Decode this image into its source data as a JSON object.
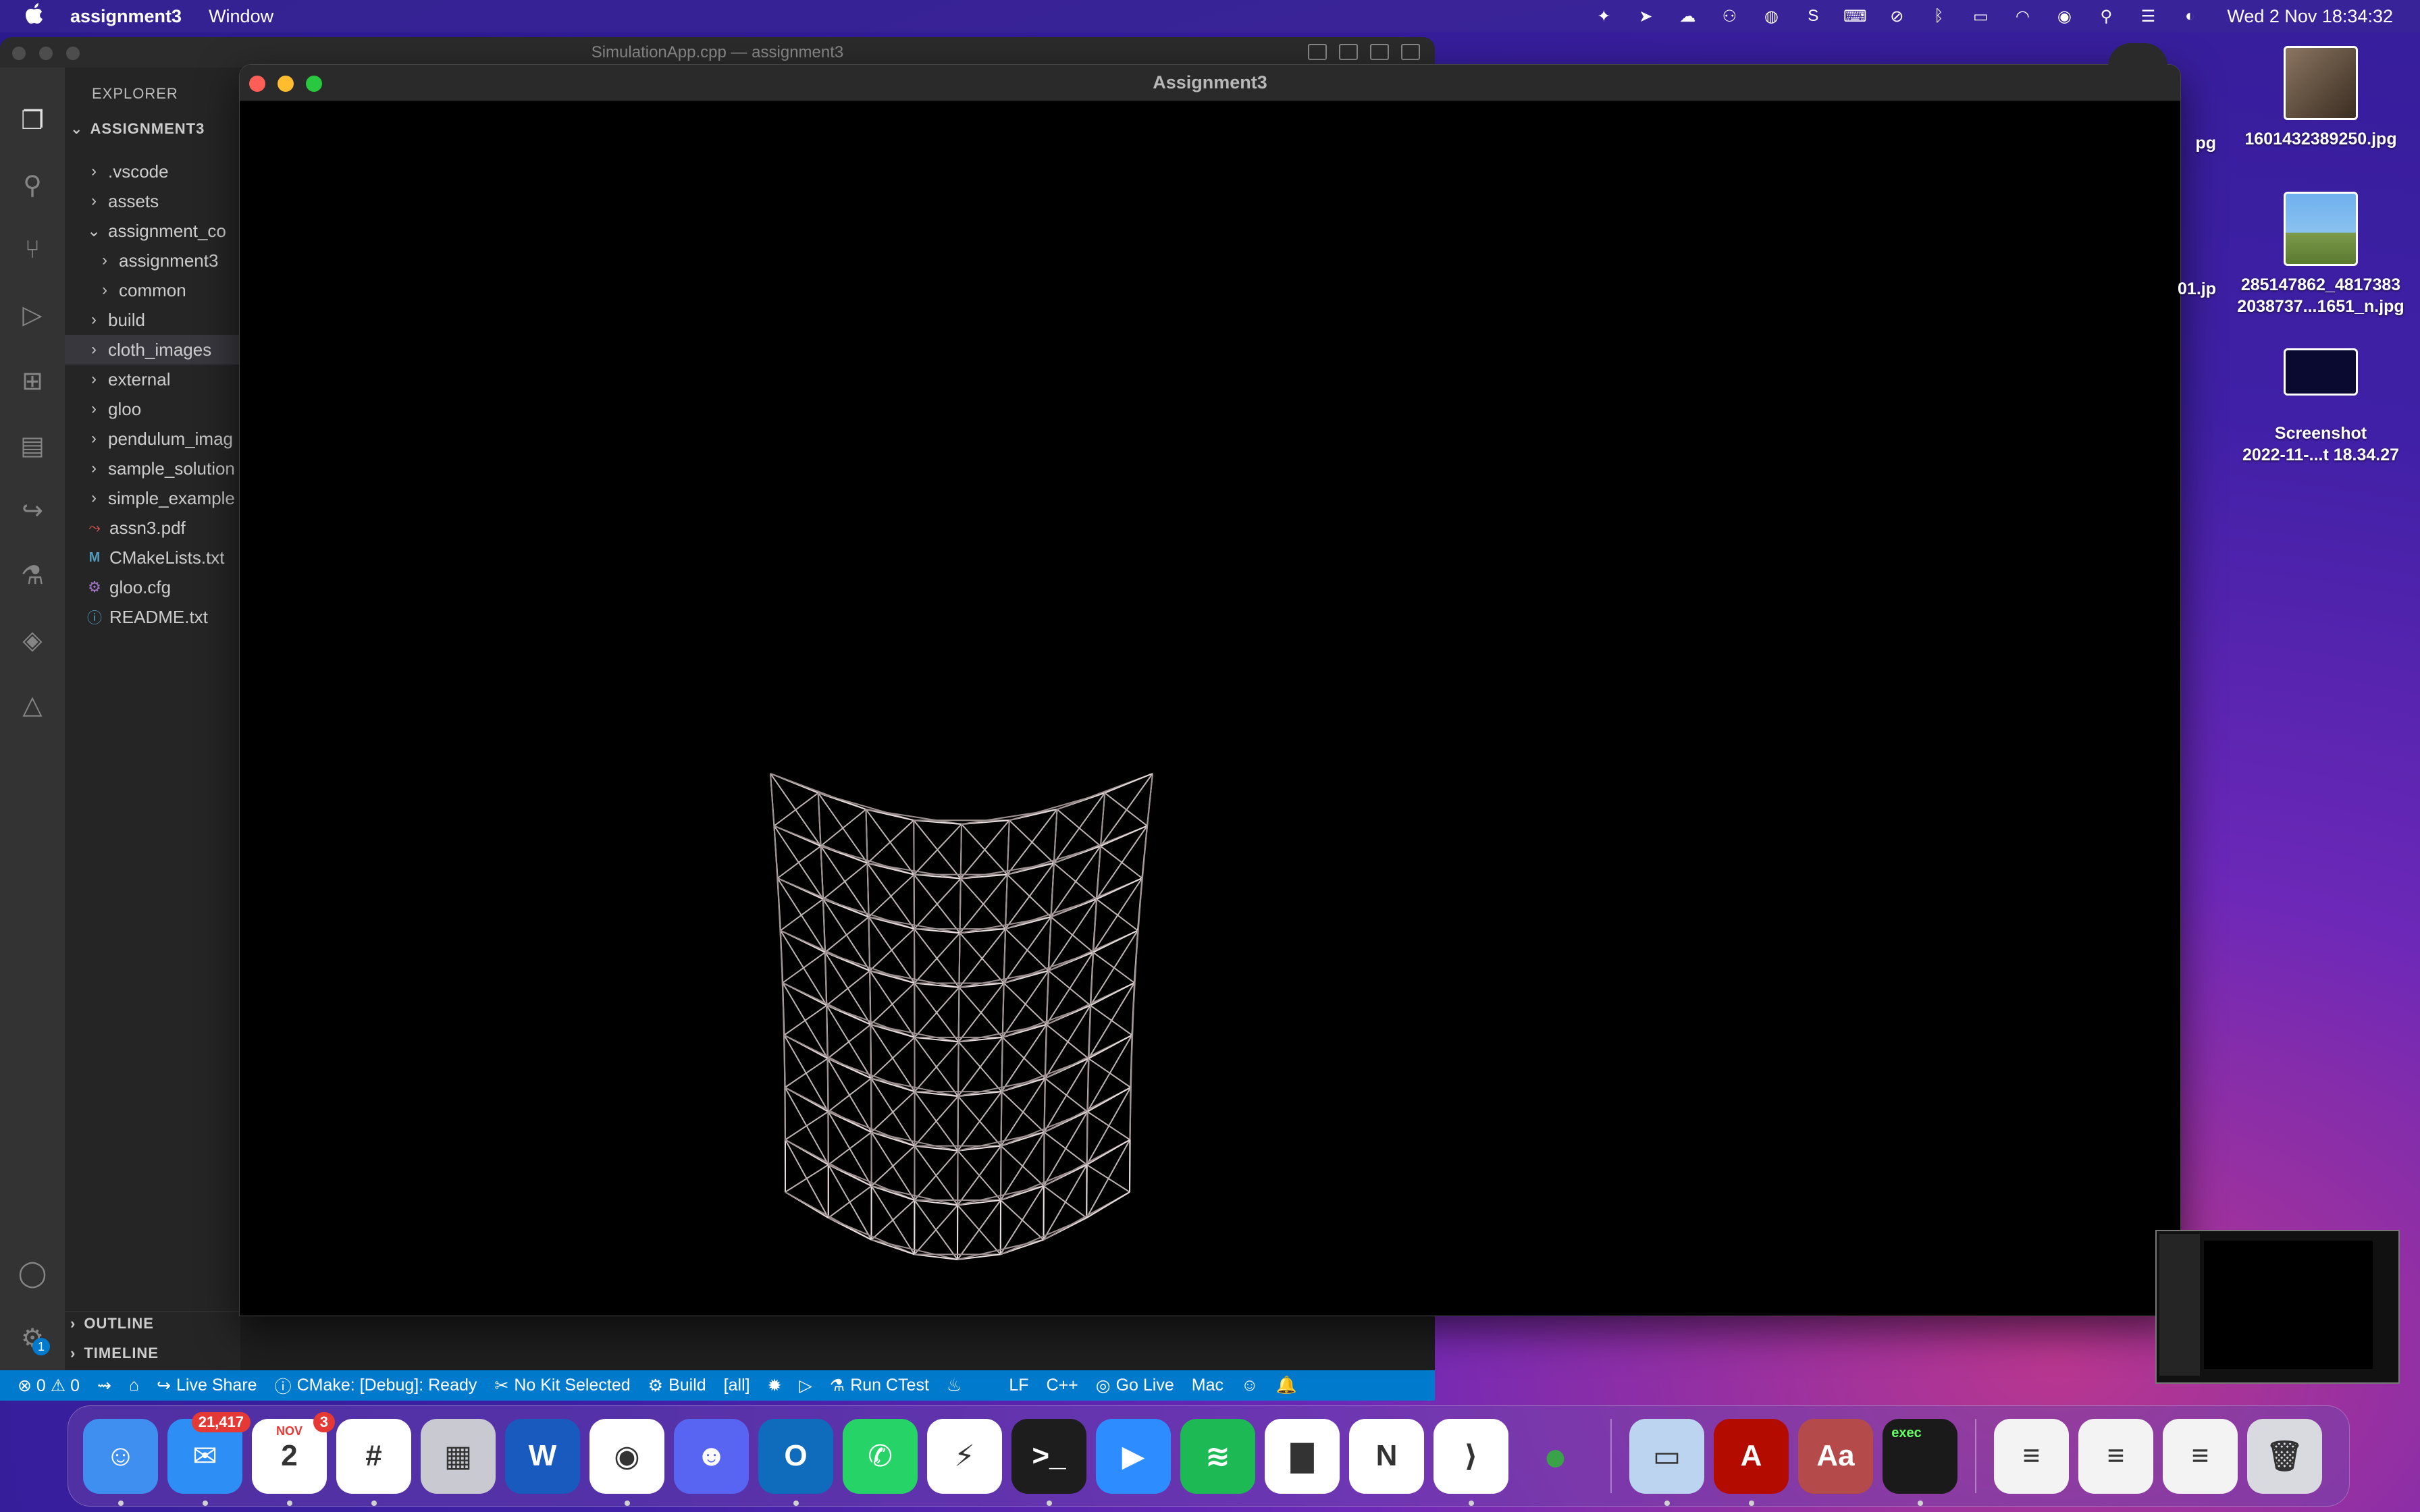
{
  "menubar": {
    "apple": "",
    "app_name": "assignment3",
    "menu_items": [
      "Window"
    ],
    "clock": "Wed 2 Nov  18:34:32"
  },
  "vscode": {
    "title": "SimulationApp.cpp — assignment3",
    "explorer_label": "EXPLORER",
    "root_folder": "ASSIGNMENT3",
    "tree": [
      {
        "label": ".vscode",
        "type": "folder",
        "depth": 0
      },
      {
        "label": "assets",
        "type": "folder",
        "depth": 0
      },
      {
        "label": "assignment_co",
        "type": "folder-open",
        "depth": 0
      },
      {
        "label": "assignment3",
        "type": "folder",
        "depth": 1
      },
      {
        "label": "common",
        "type": "folder",
        "depth": 1
      },
      {
        "label": "build",
        "type": "folder",
        "depth": 0
      },
      {
        "label": "cloth_images",
        "type": "folder",
        "depth": 0,
        "selected": true
      },
      {
        "label": "external",
        "type": "folder",
        "depth": 0
      },
      {
        "label": "gloo",
        "type": "folder",
        "depth": 0
      },
      {
        "label": "pendulum_imag",
        "type": "folder",
        "depth": 0
      },
      {
        "label": "sample_solution",
        "type": "folder",
        "depth": 0
      },
      {
        "label": "simple_example",
        "type": "folder",
        "depth": 0
      },
      {
        "label": "assn3.pdf",
        "type": "pdf",
        "depth": 0
      },
      {
        "label": "CMakeLists.txt",
        "type": "cmake",
        "depth": 0
      },
      {
        "label": "gloo.cfg",
        "type": "cfg",
        "depth": 0
      },
      {
        "label": "README.txt",
        "type": "info",
        "depth": 0
      }
    ],
    "outline_label": "OUTLINE",
    "timeline_label": "TIMELINE",
    "accounts_badge": "1",
    "statusbar": {
      "problems": "⊗ 0 ⚠ 0",
      "live_share": "Live Share",
      "cmake_status": "CMake: [Debug]: Ready",
      "kit": "No Kit Selected",
      "build": "Build",
      "build_target": "[all]",
      "run_ctest": "Run CTest",
      "eol": "LF",
      "language": "C++",
      "go_live": "Go Live",
      "platform": "Mac"
    }
  },
  "gl_window": {
    "title": "Assignment3"
  },
  "desktop": {
    "icons": [
      {
        "label": "1601432389250.jpg",
        "color": "#6b5a48"
      },
      {
        "label": "285147862_4817383\n2038737...1651_n.jpg",
        "color": "#4a88c9"
      },
      {
        "label": "Screenshot\n2022-11-...t 18.34.27",
        "color": "#0a0a30"
      }
    ],
    "partial_labels": [
      "pg",
      "01.jp"
    ]
  },
  "dock": {
    "apps": [
      {
        "name": "Finder",
        "icon": "finder-icon",
        "color": "#3f8ff0",
        "glyph": "☺",
        "running": true
      },
      {
        "name": "Mail",
        "icon": "mail-icon",
        "color": "#2d8ef5",
        "glyph": "✉",
        "badge": "21,417",
        "running": true
      },
      {
        "name": "Calendar",
        "icon": "calendar-icon",
        "color": "#ffffff",
        "glyph": "2",
        "month": "NOV",
        "badge": "3",
        "running": true
      },
      {
        "name": "Slack",
        "icon": "slack-icon",
        "color": "#ffffff",
        "glyph": "#",
        "running": true
      },
      {
        "name": "Launchpad",
        "icon": "launchpad-icon",
        "color": "#c9c9d2",
        "glyph": "▦",
        "running": false
      },
      {
        "name": "Word",
        "icon": "word-icon",
        "color": "#185abd",
        "glyph": "W",
        "running": false
      },
      {
        "name": "Chrome",
        "icon": "chrome-icon",
        "color": "#ffffff",
        "glyph": "◉",
        "running": true
      },
      {
        "name": "Discord",
        "icon": "discord-icon",
        "color": "#5865f2",
        "glyph": "☻",
        "running": false
      },
      {
        "name": "Outlook",
        "icon": "outlook-icon",
        "color": "#0f6cbd",
        "glyph": "O",
        "running": true
      },
      {
        "name": "WhatsApp",
        "icon": "whatsapp-icon",
        "color": "#25d366",
        "glyph": "✆",
        "running": false
      },
      {
        "name": "Messenger",
        "icon": "messenger-icon",
        "color": "#ffffff",
        "glyph": "⚡",
        "running": false
      },
      {
        "name": "Terminal",
        "icon": "terminal-icon",
        "color": "#1d1d1d",
        "glyph": ">_",
        "running": true
      },
      {
        "name": "Zoom",
        "icon": "zoom-icon",
        "color": "#2d8cff",
        "glyph": "▶",
        "running": false
      },
      {
        "name": "Spotify",
        "icon": "spotify-icon",
        "color": "#1db954",
        "glyph": "≋",
        "running": false
      },
      {
        "name": "Numbers",
        "icon": "numbers-icon",
        "color": "#ffffff",
        "glyph": "▇",
        "running": false
      },
      {
        "name": "Notion",
        "icon": "notion-icon",
        "color": "#ffffff",
        "glyph": "N",
        "running": false
      },
      {
        "name": "VS Code",
        "icon": "vscode-icon",
        "color": "#ffffff",
        "glyph": "⟩",
        "running": true
      },
      {
        "name": "Balls",
        "icon": "colored-balls-icon",
        "color": "transparent",
        "glyph": "●",
        "running": false
      },
      {
        "name": "Preview",
        "icon": "preview-icon",
        "color": "#bcd4ef",
        "glyph": "▭",
        "running": true
      },
      {
        "name": "Acrobat",
        "icon": "acrobat-icon",
        "color": "#b30b00",
        "glyph": "A",
        "running": true
      },
      {
        "name": "Dictionary",
        "icon": "dictionary-icon",
        "color": "#b44a4a",
        "glyph": "Aa",
        "running": false
      },
      {
        "name": "exec",
        "icon": "exec-icon",
        "color": "#1a1a1a",
        "glyph": "exec",
        "running": true
      },
      {
        "name": "Docs1",
        "icon": "document-stack-icon",
        "color": "#f3f3f3",
        "glyph": "≡",
        "running": false
      },
      {
        "name": "Docs2",
        "icon": "pdf-document-icon",
        "color": "#f3f3f3",
        "glyph": "≡",
        "running": false
      },
      {
        "name": "Docs3",
        "icon": "chrome-document-icon",
        "color": "#f3f3f3",
        "glyph": "≡",
        "running": false
      },
      {
        "name": "Trash",
        "icon": "trash-icon",
        "color": "#d9d9e0",
        "glyph": "🗑",
        "running": false
      }
    ]
  }
}
